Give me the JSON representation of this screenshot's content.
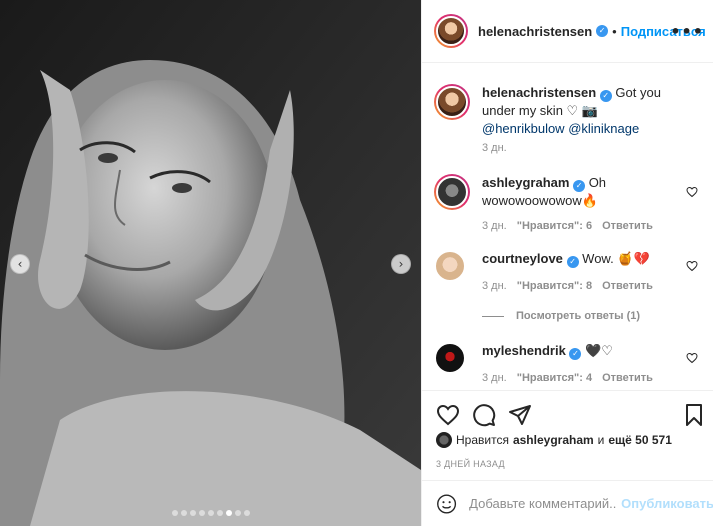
{
  "header": {
    "username": "helenachristensen",
    "separator": "•",
    "follow_label": "Подписаться",
    "more_label": "•••"
  },
  "caption": {
    "username": "helenachristensen",
    "text": "Got you under my skin ♡ 📷",
    "mentions": [
      "@henrikbulow",
      "@kliniknage"
    ],
    "time": "3 дн."
  },
  "comments": [
    {
      "username": "ashleygraham",
      "text": "Oh wowowoowowow🔥",
      "time": "3 дн.",
      "likes": "\"Нравится\": 6",
      "reply": "Ответить"
    },
    {
      "username": "courtneylove",
      "text": "Wow. 🍯💔",
      "time": "3 дн.",
      "likes": "\"Нравится\": 8",
      "reply": "Ответить"
    },
    {
      "username": "myleshendrik",
      "text": "🖤♡",
      "time": "3 дн.",
      "likes": "\"Нравится\": 4",
      "reply": "Ответить"
    }
  ],
  "view_replies": "Посмотреть ответы (1)",
  "likes": {
    "prefix": "Нравится",
    "user": "ashleygraham",
    "middle": "и",
    "count": "ещё 50 571"
  },
  "date": "3 ДНЕЙ НАЗАД",
  "add_comment": {
    "placeholder": "Добавьте комментарий...",
    "publish_label": "Опубликовать"
  },
  "carousel": {
    "total": 9,
    "active_index": 7,
    "prev_icon": "chevron-left-icon",
    "next_icon": "chevron-right-icon"
  },
  "colors": {
    "link": "#0095f6",
    "mention": "#00376b",
    "verified": "#3897f0",
    "muted": "#8e8e8e"
  }
}
